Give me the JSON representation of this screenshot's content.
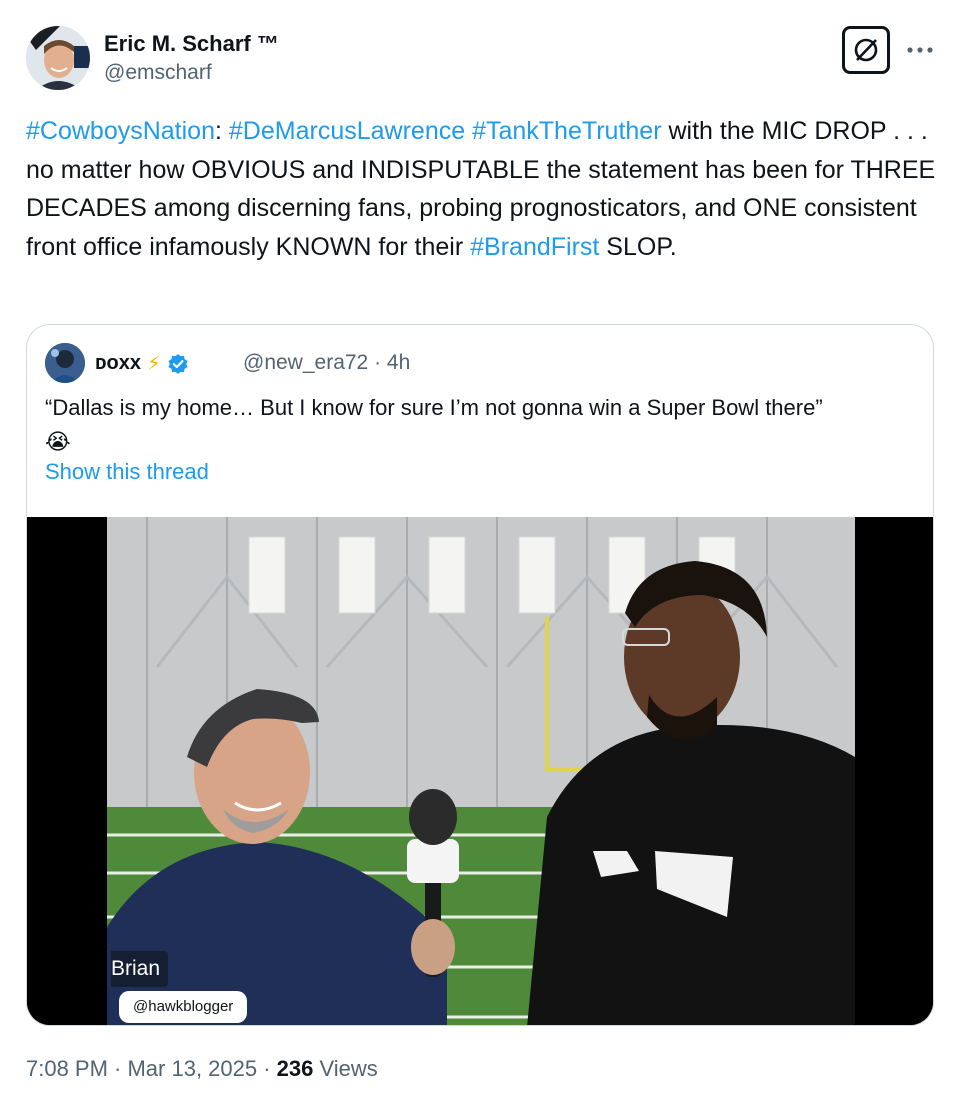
{
  "author": {
    "display_name": "Eric M. Scharf ™",
    "handle": "@emscharf"
  },
  "header_icons": {
    "grok": "grok-icon",
    "more": "more-icon"
  },
  "tweet": {
    "t1": "#CowboysNation",
    "t2": ": ",
    "t3": "#DeMarcusLawrence",
    "t4": " ",
    "t5": "#TankTheTruther",
    "t6": " with the MIC DROP . . . no matter how OBVIOUS and INDISPUTABLE the statement has been for THREE DECADES among discerning fans, probing prognosticators, and ONE consistent front office infamously KNOWN for their ",
    "t7": "#BrandFirst",
    "t8": " SLOP."
  },
  "quote": {
    "name": "ᴅᴏxx",
    "lightning": "⚡",
    "handle_time": "@new_era72 · 4h",
    "text": "“Dallas is my home… But I know for sure I’m not gonna win a Super Bowl there”",
    "emoji": "😭",
    "show_thread": "Show this thread",
    "video_caption_name": "Brian",
    "video_caption_handle": "@hawkblogger"
  },
  "footer": {
    "time_date": "7:08 PM · Mar 13, 2025 · ",
    "views_count": "236",
    "views_label": " Views"
  },
  "colors": {
    "link": "#1d9bf0",
    "secondary_text": "#536471",
    "verified": "#1d9bf0"
  }
}
